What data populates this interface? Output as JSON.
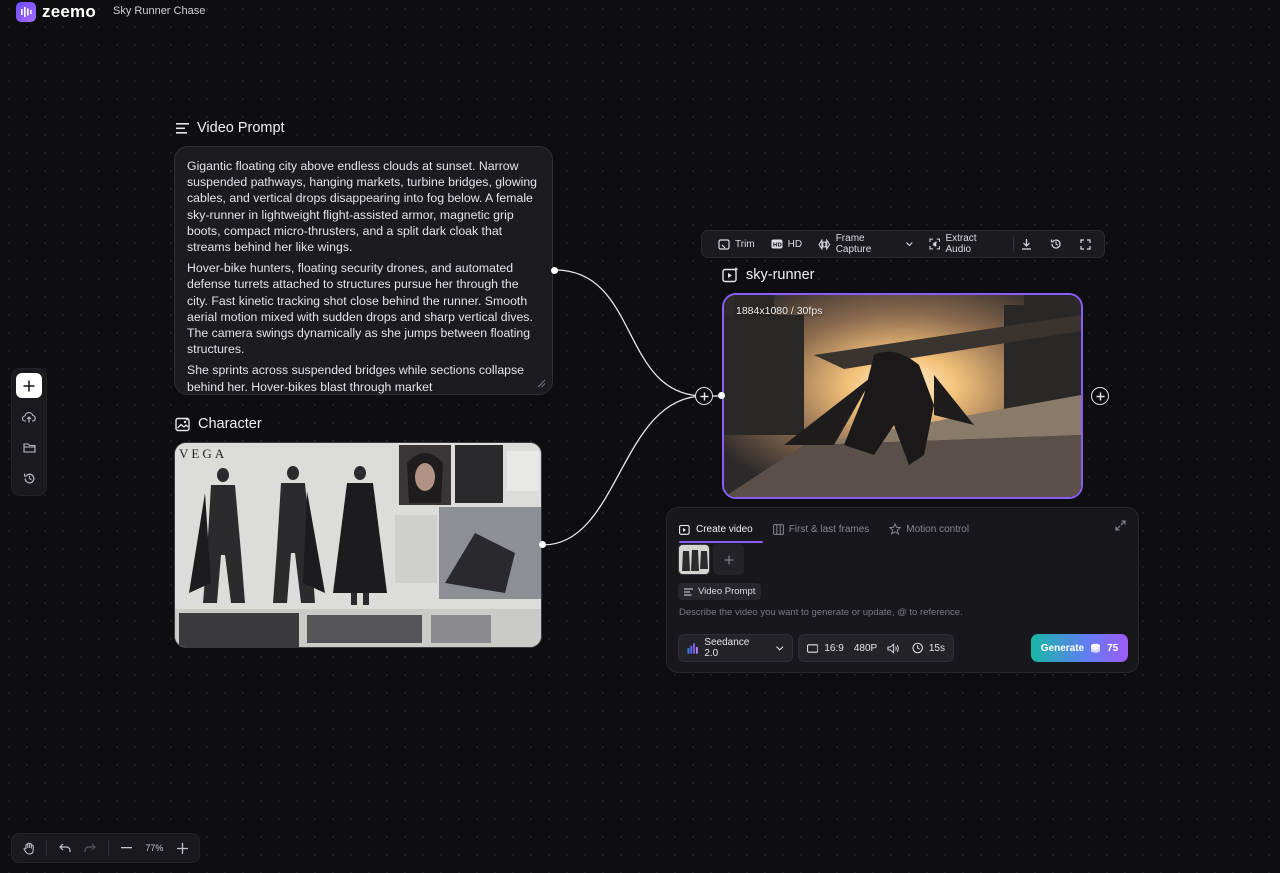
{
  "header": {
    "logo_text": "zeemo",
    "project_title": "Sky Runner Chase"
  },
  "prompt_node": {
    "label": "Video Prompt",
    "paragraphs": [
      "Gigantic floating city above endless clouds at sunset. Narrow suspended pathways, hanging markets, turbine bridges, glowing cables, and vertical drops disappearing into fog below. A female sky-runner in lightweight flight-assisted armor, magnetic grip boots, compact micro-thrusters, and a split dark cloak that streams behind her like wings.",
      "Hover-bike hunters, floating security drones, and automated defense turrets attached to structures pursue her through the city. Fast kinetic tracking shot close behind the runner. Smooth aerial motion mixed with sudden drops and sharp vertical dives. The camera swings dynamically as she jumps between floating structures.",
      "She sprints across suspended bridges while sections collapse behind her. Hover-bikes blast through market"
    ]
  },
  "character_node": {
    "label": "Character",
    "sheet_title": "VEGA"
  },
  "video_node": {
    "label": "sky-runner",
    "meta": "1884x1080 / 30fps"
  },
  "video_toolbar": {
    "trim": "Trim",
    "hd": "HD",
    "frame_capture": "Frame Capture",
    "extract_audio": "Extract Audio"
  },
  "gen_panel": {
    "tabs": [
      {
        "label": "Create video",
        "active": true
      },
      {
        "label": "First & last frames",
        "active": false
      },
      {
        "label": "Motion control",
        "active": false
      }
    ],
    "chip_label": "Video Prompt",
    "placeholder": "Describe the video you want to generate or update, @ to reference.",
    "model": "Seedance 2.0",
    "aspect": "16:9",
    "resolution": "480P",
    "duration": "15s",
    "generate_label": "Generate",
    "credits": "75"
  },
  "bottom_bar": {
    "zoom": "77%"
  },
  "colors": {
    "accent": "#8b5cf6",
    "background": "#0e0e10"
  }
}
